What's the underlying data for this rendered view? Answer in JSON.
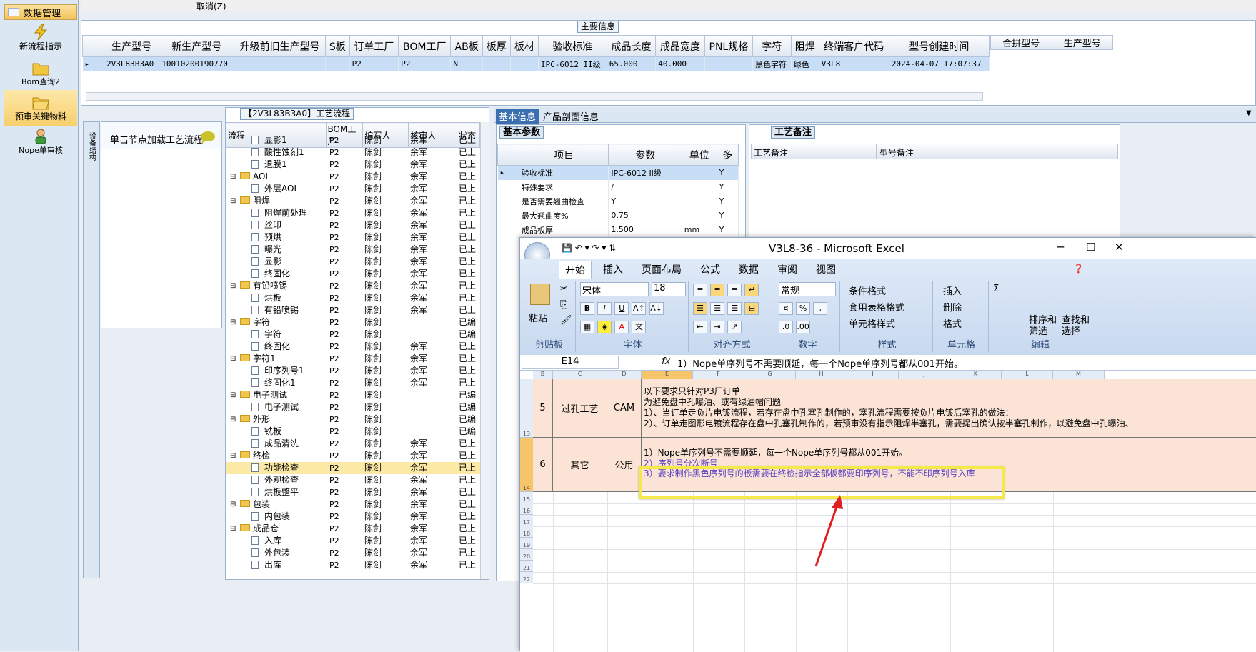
{
  "nav": {
    "header": "数据管理",
    "items": [
      {
        "label": "新流程指示"
      },
      {
        "label": "Bom查询2"
      },
      {
        "label": "预审关键物料"
      },
      {
        "label": "Nope单审核"
      }
    ]
  },
  "topbar": {
    "cancel": "取消(Z)"
  },
  "main_info": {
    "title": "主要信息",
    "columns": [
      "生产型号",
      "新生产型号",
      "升级前旧生产型号",
      "S板",
      "订单工厂",
      "BOM工厂",
      "AB板",
      "板厚",
      "板材",
      "验收标准",
      "成品长度",
      "成品宽度",
      "PNL规格",
      "字符",
      "阻焊",
      "终端客户代码",
      "型号创建时间"
    ],
    "row": [
      "2V3L83B3A0",
      "10010200190770",
      "",
      "",
      "P2",
      "P2",
      "N",
      "",
      "",
      "IPC-6012 II级",
      "65.000",
      "40.000",
      "",
      "黑色字符",
      "绿色",
      "V3L8",
      "2024-04-07 17:07:37"
    ],
    "side_columns": [
      "合拼型号",
      "生产型号"
    ]
  },
  "left_panel": {
    "vtab": "设备结构",
    "hint": "单击节点加载工艺流程"
  },
  "process": {
    "title": "【2V3L83B3A0】工艺流程",
    "columns": [
      "流程",
      "BOM工厂",
      "编写人",
      "核审人",
      "状态"
    ],
    "rows": [
      {
        "name": "显影1",
        "level": 2,
        "factory": "P2",
        "writer": "陈剑",
        "reviewer": "余军",
        "status": "已上"
      },
      {
        "name": "酸性蚀刻1",
        "level": 2,
        "factory": "P2",
        "writer": "陈剑",
        "reviewer": "余军",
        "status": "已上"
      },
      {
        "name": "退膜1",
        "level": 2,
        "factory": "P2",
        "writer": "陈剑",
        "reviewer": "余军",
        "status": "已上"
      },
      {
        "name": "AOI",
        "level": 1,
        "factory": "P2",
        "writer": "陈剑",
        "reviewer": "余军",
        "status": "已上"
      },
      {
        "name": "外层AOI",
        "level": 2,
        "factory": "P2",
        "writer": "陈剑",
        "reviewer": "余军",
        "status": "已上"
      },
      {
        "name": "阻焊",
        "level": 1,
        "factory": "P2",
        "writer": "陈剑",
        "reviewer": "余军",
        "status": "已上"
      },
      {
        "name": "阻焊前处理",
        "level": 2,
        "factory": "P2",
        "writer": "陈剑",
        "reviewer": "余军",
        "status": "已上"
      },
      {
        "name": "丝印",
        "level": 2,
        "factory": "P2",
        "writer": "陈剑",
        "reviewer": "余军",
        "status": "已上"
      },
      {
        "name": "预烘",
        "level": 2,
        "factory": "P2",
        "writer": "陈剑",
        "reviewer": "余军",
        "status": "已上"
      },
      {
        "name": "曝光",
        "level": 2,
        "factory": "P2",
        "writer": "陈剑",
        "reviewer": "余军",
        "status": "已上"
      },
      {
        "name": "显影",
        "level": 2,
        "factory": "P2",
        "writer": "陈剑",
        "reviewer": "余军",
        "status": "已上"
      },
      {
        "name": "终固化",
        "level": 2,
        "factory": "P2",
        "writer": "陈剑",
        "reviewer": "余军",
        "status": "已上"
      },
      {
        "name": "有铅喷锡",
        "level": 1,
        "factory": "P2",
        "writer": "陈剑",
        "reviewer": "余军",
        "status": "已上"
      },
      {
        "name": "烘板",
        "level": 2,
        "factory": "P2",
        "writer": "陈剑",
        "reviewer": "余军",
        "status": "已上"
      },
      {
        "name": "有铅喷锡",
        "level": 2,
        "factory": "P2",
        "writer": "陈剑",
        "reviewer": "余军",
        "status": "已上"
      },
      {
        "name": "字符",
        "level": 1,
        "factory": "P2",
        "writer": "陈剑",
        "reviewer": "",
        "status": "已编"
      },
      {
        "name": "字符",
        "level": 2,
        "factory": "P2",
        "writer": "陈剑",
        "reviewer": "",
        "status": "已编"
      },
      {
        "name": "终固化",
        "level": 2,
        "factory": "P2",
        "writer": "陈剑",
        "reviewer": "余军",
        "status": "已上"
      },
      {
        "name": "字符1",
        "level": 1,
        "factory": "P2",
        "writer": "陈剑",
        "reviewer": "余军",
        "status": "已上"
      },
      {
        "name": "印序列号1",
        "level": 2,
        "factory": "P2",
        "writer": "陈剑",
        "reviewer": "余军",
        "status": "已上"
      },
      {
        "name": "终固化1",
        "level": 2,
        "factory": "P2",
        "writer": "陈剑",
        "reviewer": "余军",
        "status": "已上"
      },
      {
        "name": "电子测试",
        "level": 1,
        "factory": "P2",
        "writer": "陈剑",
        "reviewer": "",
        "status": "已编"
      },
      {
        "name": "电子测试",
        "level": 2,
        "factory": "P2",
        "writer": "陈剑",
        "reviewer": "",
        "status": "已编"
      },
      {
        "name": "外形",
        "level": 1,
        "factory": "P2",
        "writer": "陈剑",
        "reviewer": "",
        "status": "已编"
      },
      {
        "name": "铣板",
        "level": 2,
        "factory": "P2",
        "writer": "陈剑",
        "reviewer": "",
        "status": "已编"
      },
      {
        "name": "成品清洗",
        "level": 2,
        "factory": "P2",
        "writer": "陈剑",
        "reviewer": "余军",
        "status": "已上"
      },
      {
        "name": "终检",
        "level": 1,
        "factory": "P2",
        "writer": "陈剑",
        "reviewer": "余军",
        "status": "已上"
      },
      {
        "name": "功能检查",
        "level": 2,
        "factory": "P2",
        "writer": "陈剑",
        "reviewer": "余军",
        "status": "已上",
        "selected": true
      },
      {
        "name": "外观检查",
        "level": 2,
        "factory": "P2",
        "writer": "陈剑",
        "reviewer": "余军",
        "status": "已上"
      },
      {
        "name": "烘板整平",
        "level": 2,
        "factory": "P2",
        "writer": "陈剑",
        "reviewer": "余军",
        "status": "已上"
      },
      {
        "name": "包装",
        "level": 1,
        "factory": "P2",
        "writer": "陈剑",
        "reviewer": "余军",
        "status": "已上"
      },
      {
        "name": "内包装",
        "level": 2,
        "factory": "P2",
        "writer": "陈剑",
        "reviewer": "余军",
        "status": "已上"
      },
      {
        "name": "成品仓",
        "level": 1,
        "factory": "P2",
        "writer": "陈剑",
        "reviewer": "余军",
        "status": "已上"
      },
      {
        "name": "入库",
        "level": 2,
        "factory": "P2",
        "writer": "陈剑",
        "reviewer": "余军",
        "status": "已上"
      },
      {
        "name": "外包装",
        "level": 2,
        "factory": "P2",
        "writer": "陈剑",
        "reviewer": "余军",
        "status": "已上"
      },
      {
        "name": "出库",
        "level": 2,
        "factory": "P2",
        "writer": "陈剑",
        "reviewer": "余军",
        "status": "已上"
      }
    ]
  },
  "right_tabs": {
    "basic_info": "基本信息",
    "section_info": "产品剖面信息"
  },
  "basic_params": {
    "title": "基本参数",
    "columns": [
      "项目",
      "参数",
      "单位",
      "多"
    ],
    "rows": [
      {
        "item": "验收标准",
        "value": "IPC-6012 II级",
        "unit": "",
        "flag": "Y"
      },
      {
        "item": "特殊要求",
        "value": "/",
        "unit": "",
        "flag": "Y"
      },
      {
        "item": "是否需要翘曲检查",
        "value": "Y",
        "unit": "",
        "flag": "Y"
      },
      {
        "item": "最大翘曲度%",
        "value": "0.75",
        "unit": "",
        "flag": "Y"
      },
      {
        "item": "成品板厚",
        "value": "1.500",
        "unit": "mm",
        "flag": "Y"
      }
    ]
  },
  "process_notes": {
    "title": "工艺备注",
    "col1": "工艺备注",
    "col2": "型号备注"
  },
  "excel": {
    "title": "V3L8-36 - Microsoft Excel",
    "tabs": [
      "开始",
      "插入",
      "页面布局",
      "公式",
      "数据",
      "审阅",
      "视图"
    ],
    "groups": {
      "clipboard": "剪贴板",
      "font": "字体",
      "align": "对齐方式",
      "number": "数字",
      "styles": "样式",
      "cells": "单元格",
      "edit": "编辑"
    },
    "paste": "粘贴",
    "font_name": "宋体",
    "font_size": "18",
    "number_format": "常规",
    "cond_format": "条件格式",
    "table_format": "套用表格格式",
    "cell_style": "单元格样式",
    "insert": "插入",
    "delete": "删除",
    "format": "格式",
    "sort": "排序和",
    "sort2": "筛选",
    "find": "查找和",
    "find2": "选择",
    "cell_ref": "E14",
    "formula": "1）Nope单序列号不需要顺延，每一个Nope单序列号都从001开始。",
    "col_letters": [
      "B",
      "C",
      "D",
      "E",
      "F",
      "G",
      "H",
      "I",
      "J",
      "K",
      "L",
      "M"
    ],
    "row13": {
      "num": "5",
      "item": "过孔工艺",
      "dept": "CAM",
      "line1": "以下要求只针对P3厂订单",
      "line2": "为避免盘中孔曝油、或有绿油帽问题",
      "line3": "1）、当订单走负片电镀流程，若存在盘中孔塞孔制作的，塞孔流程需要按负片电镀后塞孔的做法：",
      "line4": "2）、订单走图形电镀流程存在盘中孔塞孔制作的，若预审没有指示阻焊半塞孔，需要提出确认按半塞孔制作，以避免盘中孔曝油、"
    },
    "row14": {
      "num": "6",
      "item": "其它",
      "dept": "公用",
      "line1": "1）Nope单序列号不需要顺延，每一个Nope单序列号都从001开始。",
      "line2": "2）序列号分次断号",
      "line3": "3）要求制作黑色序列号的板需要在终检指示全部板都要印序列号，不能不印序列号入库"
    },
    "row_numbers": [
      "13",
      "14",
      "15",
      "16",
      "17",
      "18",
      "19",
      "20",
      "21",
      "22"
    ]
  },
  "colors": {
    "highlight": "#f5e94a",
    "arrow": "#e02020"
  }
}
